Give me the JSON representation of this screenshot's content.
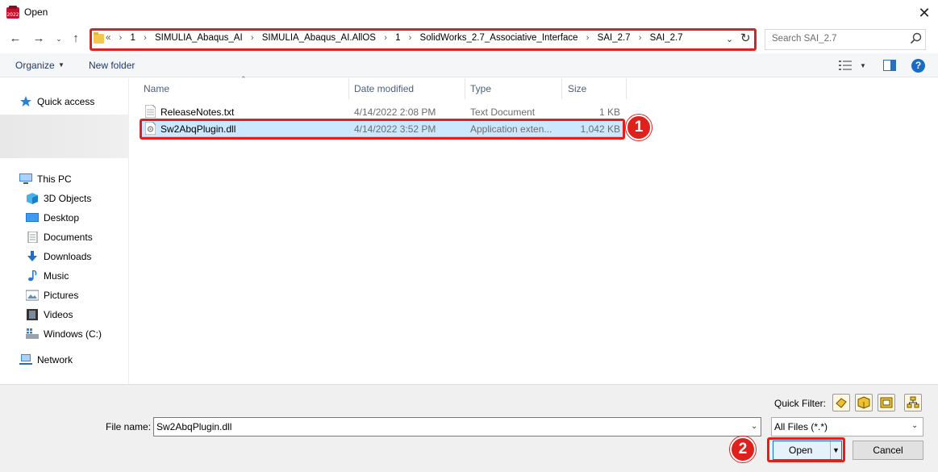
{
  "window": {
    "title": "Open"
  },
  "address": {
    "overflow": "«",
    "crumbs": [
      "1",
      "SIMULIA_Abaqus_AI",
      "SIMULIA_Abaqus_AI.AllOS",
      "1",
      "SolidWorks_2.7_Associative_Interface",
      "SAI_2.7",
      "SAI_2.7"
    ]
  },
  "search": {
    "placeholder": "Search SAI_2.7"
  },
  "toolbar": {
    "organize": "Organize",
    "new_folder": "New folder"
  },
  "sidebar": {
    "quick_access": "Quick access",
    "this_pc": "This PC",
    "items": [
      "3D Objects",
      "Desktop",
      "Documents",
      "Downloads",
      "Music",
      "Pictures",
      "Videos",
      "Windows (C:)"
    ],
    "network": "Network"
  },
  "columns": {
    "name": "Name",
    "date": "Date modified",
    "type": "Type",
    "size": "Size"
  },
  "files": [
    {
      "name": "ReleaseNotes.txt",
      "date": "4/14/2022 2:08 PM",
      "type": "Text Document",
      "size": "1 KB"
    },
    {
      "name": "Sw2AbqPlugin.dll",
      "date": "4/14/2022 3:52 PM",
      "type": "Application exten...",
      "size": "1,042 KB"
    }
  ],
  "annotations": {
    "step1": "1",
    "step2": "2",
    "highlight_color": "#e0201c"
  },
  "bottom": {
    "quick_filter": "Quick Filter:",
    "file_name_label": "File name:",
    "file_name_value": "Sw2AbqPlugin.dll",
    "file_type": "All Files (*.*)",
    "open": "Open",
    "cancel": "Cancel"
  }
}
